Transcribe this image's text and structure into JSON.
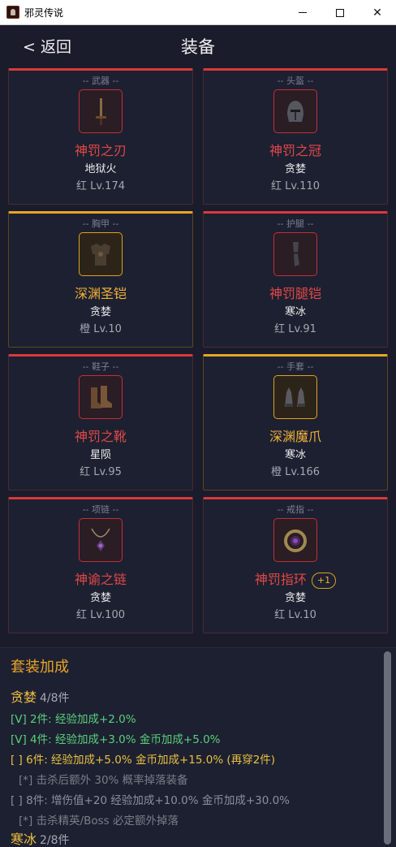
{
  "window": {
    "title": "邪灵传说"
  },
  "header": {
    "back_label": "< 返回",
    "title": "装备"
  },
  "slots": [
    {
      "slot_label": "-- 武器 --",
      "name": "神罚之刃",
      "set": "地狱火",
      "level": "红 Lv.174",
      "rarity": "red",
      "icon": "sword-icon"
    },
    {
      "slot_label": "-- 头盔 --",
      "name": "神罚之冠",
      "set": "贪婪",
      "level": "红 Lv.110",
      "rarity": "red",
      "icon": "helmet-icon"
    },
    {
      "slot_label": "-- 胸甲 --",
      "name": "深渊圣铠",
      "set": "贪婪",
      "level": "橙 Lv.10",
      "rarity": "orange",
      "icon": "chest-armor-icon"
    },
    {
      "slot_label": "-- 护腿 --",
      "name": "神罚腿铠",
      "set": "寒冰",
      "level": "红 Lv.91",
      "rarity": "red",
      "icon": "leg-armor-icon"
    },
    {
      "slot_label": "-- 鞋子 --",
      "name": "神罚之靴",
      "set": "星陨",
      "level": "红 Lv.95",
      "rarity": "red",
      "icon": "boots-icon"
    },
    {
      "slot_label": "-- 手套 --",
      "name": "深渊魔爪",
      "set": "寒冰",
      "level": "橙 Lv.166",
      "rarity": "orange",
      "icon": "gauntlets-icon"
    },
    {
      "slot_label": "-- 项链 --",
      "name": "神谕之链",
      "set": "贪婪",
      "level": "红 Lv.100",
      "rarity": "red",
      "icon": "necklace-icon"
    },
    {
      "slot_label": "-- 戒指 --",
      "name": "神罚指环",
      "set": "贪婪",
      "level": "红 Lv.10",
      "rarity": "red",
      "icon": "ring-icon",
      "badge": "+1"
    }
  ],
  "set_bonus": {
    "title": "套装加成",
    "sets": [
      {
        "name": "贪婪",
        "count": "4/8件",
        "lines": [
          "[V] 2件: 经验加成+2.0%",
          "[V] 4件: 经验加成+3.0%  金币加成+5.0%",
          "[ ] 6件: 经验加成+5.0%  金币加成+15.0% (再穿2件)",
          "[*] 击杀后额外 30% 概率掉落装备",
          "[ ] 8件: 增伤值+20  经验加成+10.0%  金币加成+30.0%",
          "[*] 击杀精英/Boss 必定额外掉落"
        ]
      },
      {
        "name": "寒冰",
        "count": "2/8件"
      }
    ]
  },
  "colors": {
    "red": "#d93a3a",
    "orange": "#e8a428",
    "green": "#5ad07a",
    "background": "#1a1c2b"
  }
}
